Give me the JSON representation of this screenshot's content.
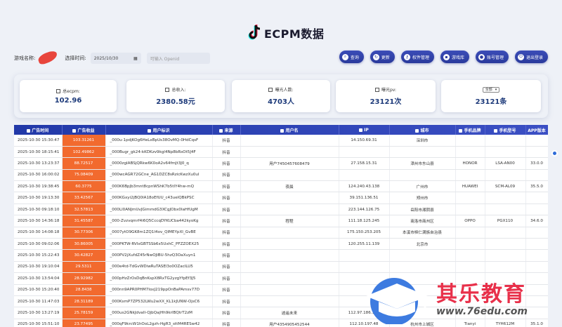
{
  "app": {
    "title": "ECPM数据"
  },
  "filters": {
    "game_label": "游戏名称:",
    "time_label": "选择时间:",
    "date_value": "2025/10/30",
    "openid_placeholder": "可输入 Openid"
  },
  "buttons": [
    {
      "label": "查询",
      "icon": "search-icon"
    },
    {
      "label": "更新",
      "icon": "refresh-icon"
    },
    {
      "label": "权件管理",
      "icon": "key-icon"
    },
    {
      "label": "游戏库",
      "icon": "gamepad-icon"
    },
    {
      "label": "账号管理",
      "icon": "user-icon"
    },
    {
      "label": "退出登录",
      "icon": "logout-icon"
    }
  ],
  "stats": [
    {
      "label": "总ecpm:",
      "value": "102.96"
    },
    {
      "label": "总收入:",
      "value": "2380.58元"
    },
    {
      "label": "曝光人数:",
      "value": "4703人"
    },
    {
      "label": "曝光pv:",
      "value": "23121次"
    },
    {
      "label": "全部",
      "value": "23121条"
    }
  ],
  "table": {
    "columns": [
      "广告时间",
      "广告收益",
      "用户标识",
      "来源",
      "用户名",
      "IP",
      "城市",
      "手机品牌",
      "手机型号",
      "APP版本"
    ],
    "rows": [
      [
        "2025-10-30 15:30:47",
        "103.31261",
        "_000u-1pdjKOg6HeLxBpUs38OvMQ-0HdCqsF",
        "抖音",
        "",
        "14.150.69.31",
        "深圳市",
        "",
        "",
        ""
      ],
      [
        "2025-10-30 18:15:41",
        "102.49862",
        "_000Bugr_gk24-kKDKzv9kgl4Np8bRsOt5J4F",
        "抖音",
        "",
        "",
        "",
        "",
        "",
        ""
      ],
      [
        "2025-10-30 13:23:37",
        "88.72517",
        "_0000zgIABSjQRkw6K0oA2v64fmJt3J0_q",
        "抖音",
        "用户7450457608479",
        "27.158.15.31",
        "漳州市东山县",
        "HONOR",
        "LSA-AN00",
        "33.0.0"
      ],
      [
        "2025-10-30 16:00:02",
        "75.08409",
        "_000wcAGR72GCne_AG1DZC8sRzicKwzXu0ul",
        "抖音",
        "",
        "",
        "",
        "",
        "",
        ""
      ],
      [
        "2025-10-30 19:38:45",
        "60.3775",
        "_000K6BpJb3mnt8cpnWShK7b5tIY4hw-mQ",
        "抖音",
        "夜晨",
        "124.240.43.138",
        "广州市",
        "HUAWEI",
        "SCM-AL09",
        "35.5.0"
      ],
      [
        "2025-10-30 19:13:30",
        "33.42567",
        "_000KGxyi2jBQ0lA18oEfUU_c43uelQBkPSC",
        "抖音",
        "",
        "39.151.136.51",
        "郑州市",
        "",
        "",
        ""
      ],
      [
        "2025-10-30 09:18:10",
        "32.57813",
        "_000Ll0ANJmUvJGimmdG3XCgJObx0IaHfUgM",
        "抖音",
        "",
        "223.144.126.75",
        "岳阳市湘阴县",
        "",
        "",
        ""
      ],
      [
        "2025-10-30 14:36:18",
        "31.45587",
        "_000-Zvzvqmrf4i6Q5CccqDYKUCba442kyoKg",
        "抖音",
        "程程",
        "111.18.125.245",
        "商洛市商州区",
        "OPPO",
        "PGX110",
        "34.6.0"
      ],
      [
        "2025-10-30 14:08:18",
        "30.77306",
        "_0007ytO9GK8m1ZQ1I4ov_QIMEYpXI_GvBE",
        "抖音",
        "",
        "175.150.253.205",
        "本溪市桓仁满族自治县",
        "",
        "",
        ""
      ],
      [
        "2025-10-30 09:02:06",
        "30.86005",
        "_000PKTW-RVIxGBTSSb6x5UxhC_PFZZOEX25",
        "抖音",
        "",
        "120.255.11.139",
        "北京市",
        "",
        "",
        ""
      ],
      [
        "2025-10-30 15:22:43",
        "30.42827",
        "_000PV2jXufdZ45rNwOJiBU-5hzQ3OaXuyn1",
        "抖音",
        "",
        "",
        "",
        "",
        "",
        ""
      ],
      [
        "2025-10-30 19:10:04",
        "29.5311",
        "_000e4td-TdGvWDiwRuTASEl3o0OZacILU5",
        "抖音",
        "",
        "",
        "",
        "",
        "",
        ""
      ],
      [
        "2025-10-30 13:54:04",
        "28.92982",
        "_000pHzZrOsDqBnKspX8RxTG2yzgYfpEf3J5",
        "抖音",
        "",
        "",
        "",
        "",
        "",
        ""
      ],
      [
        "2025-10-30 15:20:40",
        "28.8438",
        "_000nn9APR0PHM7IoxJ219ppOnBaPAmsv77D",
        "抖音",
        "",
        "",
        "",
        "",
        "",
        ""
      ],
      [
        "2025-10-30 11:47:03",
        "28.31189",
        "_000KsmP7ZP532LWu2wXX_KL1kJUNW-OjsC6",
        "抖音",
        "",
        "",
        "",
        "",
        "",
        ""
      ],
      [
        "2025-10-30 13:27:19",
        "25.78159",
        "_000us2GNkJdvaII-QjbQajHh9krlBQtrT2zM",
        "抖音",
        "逍遥未来",
        "112.97.186.125",
        "",
        "",
        "",
        ""
      ],
      [
        "2025-10-30 15:51:10",
        "23.77495",
        "_000qF9krcW1hOoL2gzh-HgR3_sttM4RESw42",
        "抖音",
        "用户4354905452544",
        "112.10.197.48",
        "杭州市上城区",
        "Tianyi",
        "TYH612M",
        "35.1.0"
      ]
    ]
  },
  "watermark": {
    "title": "其乐教育",
    "url": "www.76edu.com"
  }
}
